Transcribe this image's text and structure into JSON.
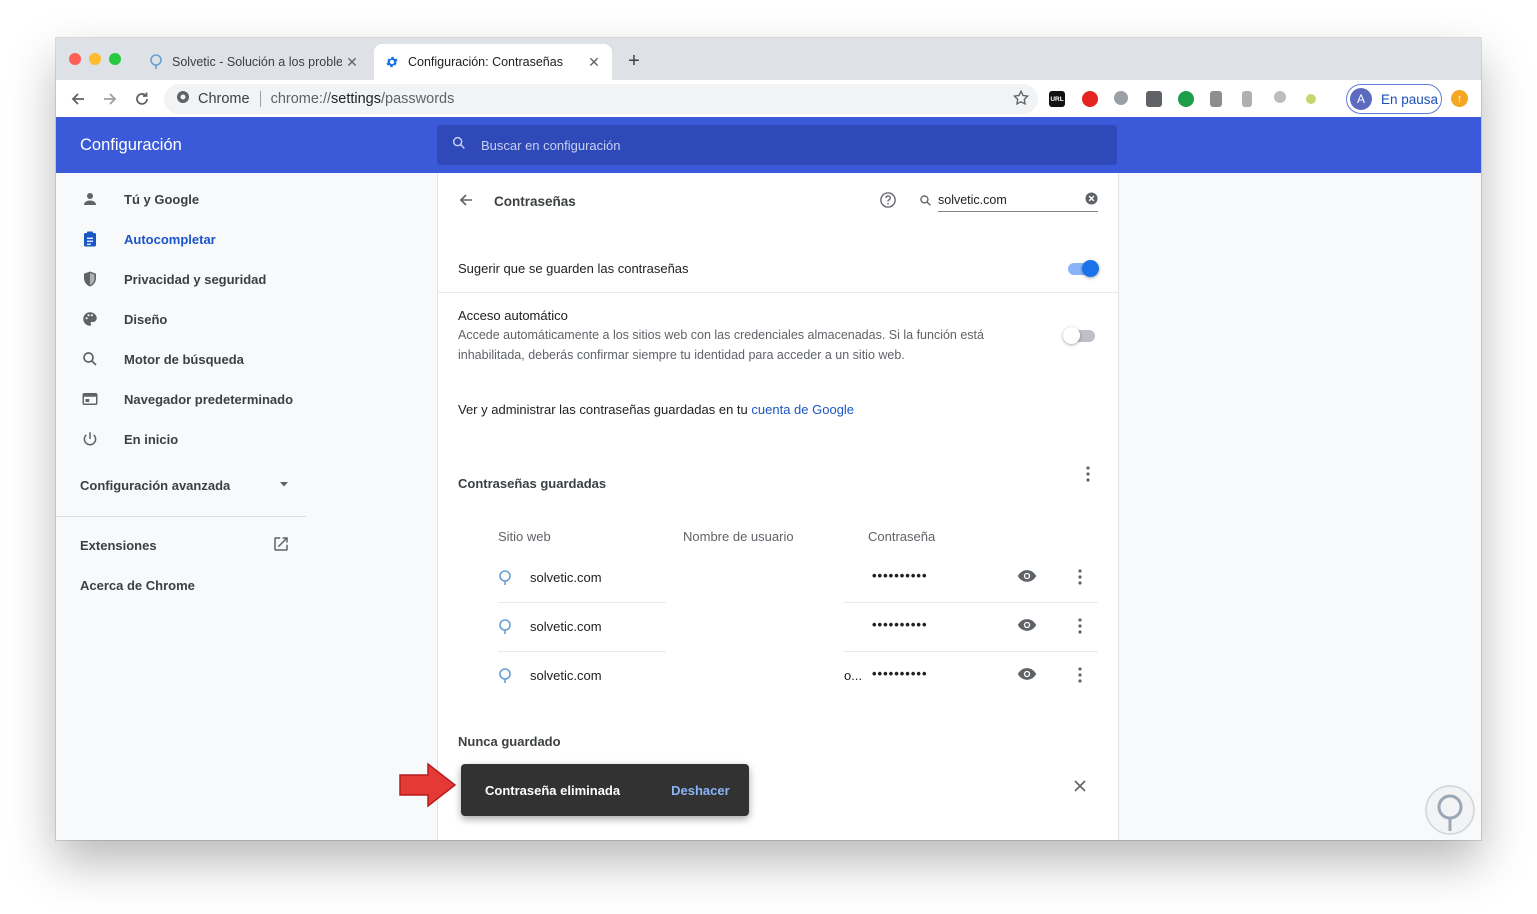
{
  "browser": {
    "tabs": [
      {
        "title": "Solvetic - Solución a los problem",
        "active": false
      },
      {
        "title": "Configuración: Contraseñas",
        "active": true
      }
    ],
    "omnibox": {
      "chip": "Chrome",
      "url_prefix": "chrome://",
      "url_bold": "settings",
      "url_suffix": "/passwords"
    },
    "extensions": [
      "URL"
    ],
    "profile": {
      "initial": "A",
      "label": "En pausa"
    }
  },
  "header": {
    "title": "Configuración",
    "search_placeholder": "Buscar en configuración"
  },
  "sidebar": {
    "items": [
      {
        "label": "Tú y Google",
        "icon": "person-icon"
      },
      {
        "label": "Autocompletar",
        "icon": "clipboard-icon",
        "active": true
      },
      {
        "label": "Privacidad y seguridad",
        "icon": "shield-icon"
      },
      {
        "label": "Diseño",
        "icon": "palette-icon"
      },
      {
        "label": "Motor de búsqueda",
        "icon": "search-icon"
      },
      {
        "label": "Navegador predeterminado",
        "icon": "browser-icon"
      },
      {
        "label": "En inicio",
        "icon": "power-icon"
      }
    ],
    "advanced": "Configuración avanzada",
    "extensions": "Extensiones",
    "about": "Acerca de Chrome"
  },
  "passwords": {
    "title": "Contraseñas",
    "search_value": "solvetic.com",
    "offer_to_save": {
      "label": "Sugerir que se guarden las contraseñas",
      "enabled": true
    },
    "auto_signin": {
      "title": "Acceso automático",
      "description_line1": "Accede automáticamente a los sitios web con las credenciales almacenadas. Si la función está",
      "description_line2": "inhabilitada, deberás confirmar siempre tu identidad para acceder a un sitio web.",
      "enabled": false
    },
    "account_text": "Ver y administrar las contraseñas guardadas en tu",
    "account_link": "cuenta de Google",
    "saved_heading": "Contraseñas guardadas",
    "columns": [
      "Sitio web",
      "Nombre de usuario",
      "Contraseña"
    ],
    "rows": [
      {
        "site": "solvetic.com",
        "user": "",
        "password": "••••••••••"
      },
      {
        "site": "solvetic.com",
        "user": "",
        "password": "••••••••••"
      },
      {
        "site": "solvetic.com",
        "user": "o...",
        "password": "••••••••••"
      }
    ],
    "never_saved_heading": "Nunca guardado"
  },
  "toast": {
    "message": "Contraseña eliminada",
    "action": "Deshacer"
  },
  "colors": {
    "header": "#3a5ad9",
    "accent": "#1a73e8",
    "toast": "#323232",
    "arrow": "#e53935"
  }
}
